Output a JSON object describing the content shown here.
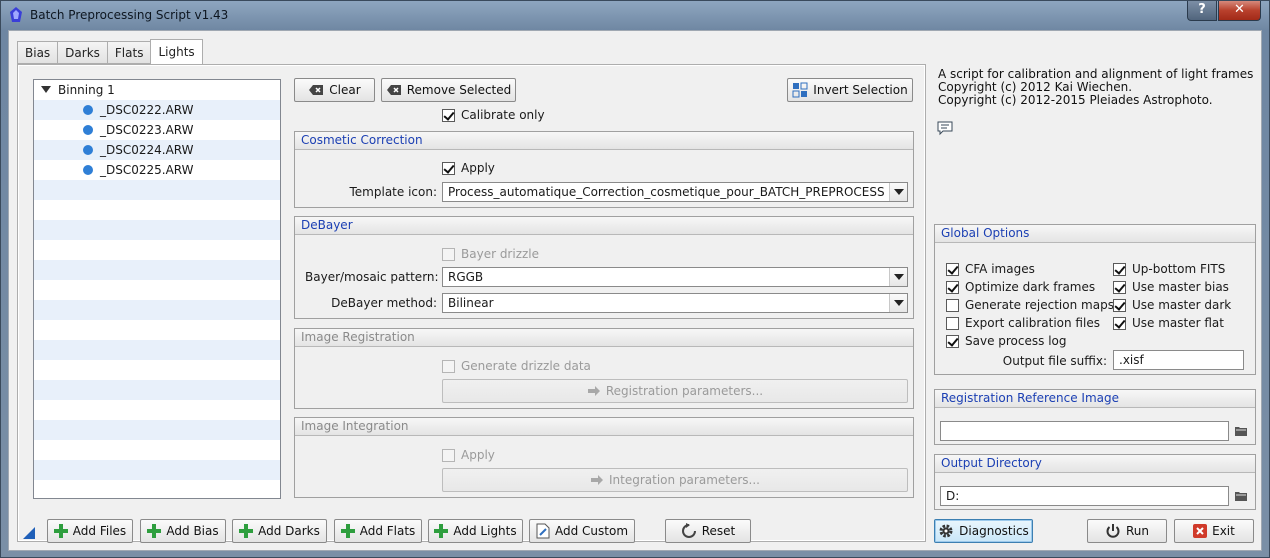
{
  "window": {
    "title": "Batch Preprocessing Script v1.43",
    "help_label": "?",
    "close_label": "✕"
  },
  "tabs": [
    {
      "label": "Bias"
    },
    {
      "label": "Darks"
    },
    {
      "label": "Flats"
    },
    {
      "label": "Lights",
      "active": true
    }
  ],
  "tree": {
    "group_label": "Binning 1",
    "files": [
      "_DSC0222.ARW",
      "_DSC0223.ARW",
      "_DSC0224.ARW",
      "_DSC0225.ARW"
    ]
  },
  "toolbar": {
    "clear": "Clear",
    "remove_selected": "Remove Selected",
    "invert_selection": "Invert Selection"
  },
  "calibrate_only": {
    "label": "Calibrate only",
    "checked": true
  },
  "cosmetic": {
    "title": "Cosmetic Correction",
    "apply_label": "Apply",
    "apply_checked": true,
    "template_label": "Template icon:",
    "template_value": "Process_automatique_Correction_cosmetique_pour_BATCH_PREPROCESS"
  },
  "debayer": {
    "title": "DeBayer",
    "drizzle_label": "Bayer drizzle",
    "pattern_label": "Bayer/mosaic pattern:",
    "pattern_value": "RGGB",
    "method_label": "DeBayer method:",
    "method_value": "Bilinear"
  },
  "registration": {
    "title": "Image Registration",
    "drizzle_label": "Generate drizzle data",
    "params_label": "Registration parameters..."
  },
  "integration": {
    "title": "Image Integration",
    "apply_label": "Apply",
    "params_label": "Integration parameters..."
  },
  "info": {
    "text": "A script for calibration and alignment of light frames\nCopyright (c) 2012 Kai Wiechen.\nCopyright (c) 2012-2015 Pleiades Astrophoto."
  },
  "global_options": {
    "title": "Global Options",
    "left": [
      {
        "label": "CFA images",
        "checked": true
      },
      {
        "label": "Optimize dark frames",
        "checked": true
      },
      {
        "label": "Generate rejection maps",
        "checked": false
      },
      {
        "label": "Export calibration files",
        "checked": false
      },
      {
        "label": "Save process log",
        "checked": true
      }
    ],
    "right": [
      {
        "label": "Up-bottom FITS",
        "checked": true
      },
      {
        "label": "Use master bias",
        "checked": true
      },
      {
        "label": "Use master dark",
        "checked": true
      },
      {
        "label": "Use master flat",
        "checked": true
      }
    ],
    "suffix_label": "Output file suffix:",
    "suffix_value": ".xisf"
  },
  "reg_reference": {
    "title": "Registration Reference Image",
    "value": ""
  },
  "output_dir": {
    "title": "Output Directory",
    "value": "D:"
  },
  "bottom": {
    "add_files": "Add Files",
    "add_bias": "Add Bias",
    "add_darks": "Add Darks",
    "add_flats": "Add Flats",
    "add_lights": "Add Lights",
    "add_custom": "Add Custom",
    "reset": "Reset",
    "diagnostics": "Diagnostics",
    "run": "Run",
    "exit": "Exit"
  },
  "colors": {
    "accent": "#1b3fb3",
    "add_icon": "#2e9e3e",
    "exit_icon": "#d03a2a",
    "file_dot": "#2f7fd6"
  }
}
